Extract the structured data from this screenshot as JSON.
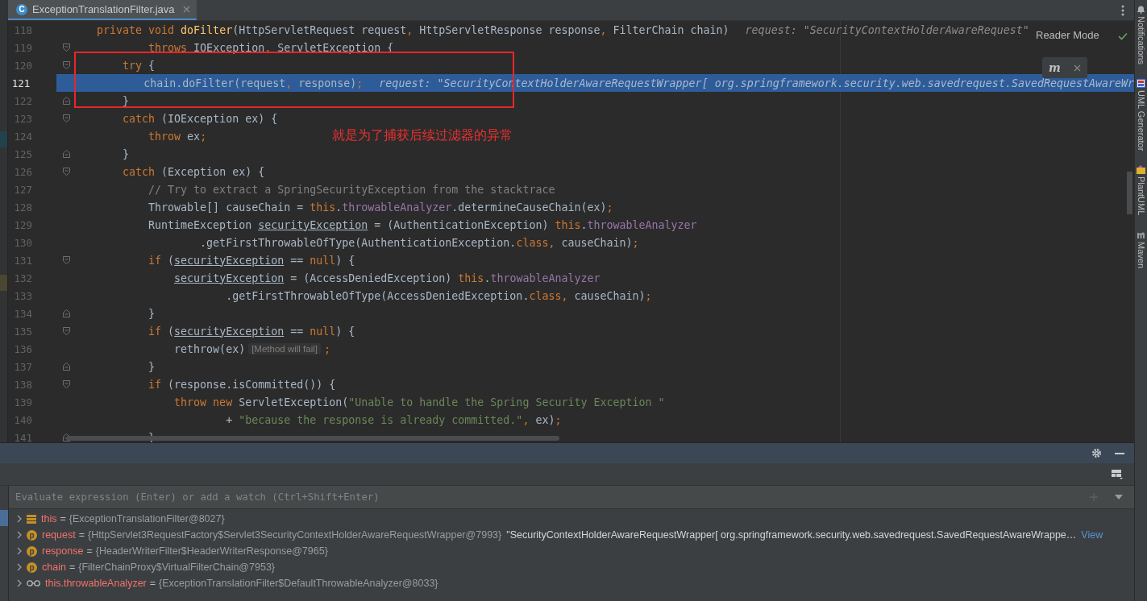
{
  "tab": {
    "icon_letter": "C",
    "label": "ExceptionTranslationFilter.java",
    "selected": true
  },
  "editor": {
    "reader_mode": "Reader Mode",
    "maven_widget": {
      "logo": "m"
    },
    "lines": [
      {
        "number": "118",
        "fold_start": false,
        "fold_end": false,
        "selected": false,
        "tokens": [
          {
            "kind": "kw",
            "t": "    private void "
          },
          {
            "kind": "fn",
            "t": "doFilter"
          },
          {
            "kind": "txt",
            "t": "(HttpServletRequest request"
          },
          {
            "kind": "kw",
            "t": ","
          },
          {
            "kind": "txt",
            "t": " HttpServletResponse response"
          },
          {
            "kind": "kw",
            "t": ","
          },
          {
            "kind": "txt",
            "t": " FilterChain chain)"
          },
          {
            "kind": "hint",
            "t": "request: \"SecurityContextHolderAwareRequest\""
          }
        ]
      },
      {
        "number": "119",
        "fold_start": true,
        "fold_end": false,
        "selected": false,
        "tokens": [
          {
            "kind": "kw",
            "t": "            throws "
          },
          {
            "kind": "txt",
            "t": "IOException"
          },
          {
            "kind": "kw",
            "t": ","
          },
          {
            "kind": "txt",
            "t": " ServletException {"
          }
        ]
      },
      {
        "number": "120",
        "fold_start": true,
        "fold_end": false,
        "selected": false,
        "tokens": [
          {
            "kind": "kw",
            "t": "        try"
          },
          {
            "kind": "txt",
            "t": " {"
          }
        ]
      },
      {
        "number": "121",
        "fold_start": false,
        "fold_end": false,
        "selected": true,
        "tokens": [
          {
            "kind": "txt",
            "t": "            chain.doFilter(request"
          },
          {
            "kind": "kw",
            "t": ","
          },
          {
            "kind": "txt",
            "t": " response)"
          },
          {
            "kind": "kw",
            "t": ";"
          },
          {
            "kind": "hint",
            "t": "request: \"SecurityContextHolderAwareRequestWrapper[ org.springframework.security.web.savedrequest.SavedRequestAwareWr"
          }
        ]
      },
      {
        "number": "122",
        "fold_start": false,
        "fold_end": true,
        "selected": false,
        "tokens": [
          {
            "kind": "txt",
            "t": "        }"
          }
        ]
      },
      {
        "number": "123",
        "fold_start": true,
        "fold_end": false,
        "selected": false,
        "tokens": [
          {
            "kind": "kw",
            "t": "        catch"
          },
          {
            "kind": "txt",
            "t": " (IOException ex) {"
          }
        ]
      },
      {
        "number": "124",
        "fold_start": false,
        "fold_end": false,
        "selected": false,
        "tokens": [
          {
            "kind": "kw",
            "t": "            throw"
          },
          {
            "kind": "txt",
            "t": " ex"
          },
          {
            "kind": "kw",
            "t": ";"
          }
        ]
      },
      {
        "number": "125",
        "fold_start": false,
        "fold_end": true,
        "selected": false,
        "tokens": [
          {
            "kind": "txt",
            "t": "        }"
          }
        ]
      },
      {
        "number": "126",
        "fold_start": true,
        "fold_end": false,
        "selected": false,
        "tokens": [
          {
            "kind": "kw",
            "t": "        catch"
          },
          {
            "kind": "txt",
            "t": " (Exception ex) {"
          }
        ]
      },
      {
        "number": "127",
        "fold_start": false,
        "fold_end": false,
        "selected": false,
        "tokens": [
          {
            "kind": "cmt",
            "t": "            // Try to extract a SpringSecurityException from the stacktrace"
          }
        ]
      },
      {
        "number": "128",
        "fold_start": false,
        "fold_end": false,
        "selected": false,
        "tokens": [
          {
            "kind": "txt",
            "t": "            Throwable[] causeChain = "
          },
          {
            "kind": "kw",
            "t": "this"
          },
          {
            "kind": "field",
            "t": ".throwableAnalyzer"
          },
          {
            "kind": "txt",
            "t": ".determineCauseChain(ex)"
          },
          {
            "kind": "kw",
            "t": ";"
          }
        ]
      },
      {
        "number": "129",
        "fold_start": false,
        "fold_end": false,
        "selected": false,
        "tokens": [
          {
            "kind": "txt",
            "t": "            RuntimeException "
          },
          {
            "kind": "ul",
            "t": "securityException"
          },
          {
            "kind": "txt",
            "t": " = (AuthenticationException) "
          },
          {
            "kind": "kw",
            "t": "this"
          },
          {
            "kind": "field",
            "t": ".throwableAnalyzer"
          }
        ]
      },
      {
        "number": "130",
        "fold_start": false,
        "fold_end": false,
        "selected": false,
        "tokens": [
          {
            "kind": "txt",
            "t": "                    .getFirstThrowableOfType(AuthenticationException."
          },
          {
            "kind": "kw",
            "t": "class"
          },
          {
            "kind": "kw",
            "t": ","
          },
          {
            "kind": "txt",
            "t": " causeChain)"
          },
          {
            "kind": "kw",
            "t": ";"
          }
        ]
      },
      {
        "number": "131",
        "fold_start": true,
        "fold_end": false,
        "selected": false,
        "tokens": [
          {
            "kind": "kw",
            "t": "            if"
          },
          {
            "kind": "txt",
            "t": " ("
          },
          {
            "kind": "ul",
            "t": "securityException"
          },
          {
            "kind": "txt",
            "t": " == "
          },
          {
            "kind": "kw",
            "t": "null"
          },
          {
            "kind": "txt",
            "t": ") {"
          }
        ]
      },
      {
        "number": "132",
        "fold_start": false,
        "fold_end": false,
        "selected": false,
        "tokens": [
          {
            "kind": "ul",
            "t": "                securityException"
          },
          {
            "kind": "txt",
            "t": " = (AccessDeniedException) "
          },
          {
            "kind": "kw",
            "t": "this"
          },
          {
            "kind": "field",
            "t": ".throwableAnalyzer"
          }
        ]
      },
      {
        "number": "133",
        "fold_start": false,
        "fold_end": false,
        "selected": false,
        "tokens": [
          {
            "kind": "txt",
            "t": "                        .getFirstThrowableOfType(AccessDeniedException."
          },
          {
            "kind": "kw",
            "t": "class"
          },
          {
            "kind": "kw",
            "t": ","
          },
          {
            "kind": "txt",
            "t": " causeChain)"
          },
          {
            "kind": "kw",
            "t": ";"
          }
        ]
      },
      {
        "number": "134",
        "fold_start": false,
        "fold_end": true,
        "selected": false,
        "tokens": [
          {
            "kind": "txt",
            "t": "            }"
          }
        ]
      },
      {
        "number": "135",
        "fold_start": true,
        "fold_end": false,
        "selected": false,
        "tokens": [
          {
            "kind": "kw",
            "t": "            if"
          },
          {
            "kind": "txt",
            "t": " ("
          },
          {
            "kind": "ul",
            "t": "securityException"
          },
          {
            "kind": "txt",
            "t": " == "
          },
          {
            "kind": "kw",
            "t": "null"
          },
          {
            "kind": "txt",
            "t": ") {"
          }
        ]
      },
      {
        "number": "136",
        "fold_start": false,
        "fold_end": false,
        "selected": false,
        "tokens": [
          {
            "kind": "txt",
            "t": "                rethrow(ex)"
          },
          {
            "kind": "chip",
            "t": "[Method will fail]"
          },
          {
            "kind": "kw",
            "t": ";"
          }
        ]
      },
      {
        "number": "137",
        "fold_start": false,
        "fold_end": true,
        "selected": false,
        "tokens": [
          {
            "kind": "txt",
            "t": "            }"
          }
        ]
      },
      {
        "number": "138",
        "fold_start": true,
        "fold_end": false,
        "selected": false,
        "tokens": [
          {
            "kind": "kw",
            "t": "            if"
          },
          {
            "kind": "txt",
            "t": " (response.isCommitted()) {"
          }
        ]
      },
      {
        "number": "139",
        "fold_start": false,
        "fold_end": false,
        "selected": false,
        "tokens": [
          {
            "kind": "kw",
            "t": "                throw new "
          },
          {
            "kind": "txt",
            "t": "ServletException("
          },
          {
            "kind": "str",
            "t": "\"Unable to handle the Spring Security Exception \""
          }
        ]
      },
      {
        "number": "140",
        "fold_start": false,
        "fold_end": false,
        "selected": false,
        "tokens": [
          {
            "kind": "txt",
            "t": "                        + "
          },
          {
            "kind": "str",
            "t": "\"because the response is already committed.\""
          },
          {
            "kind": "kw",
            "t": ","
          },
          {
            "kind": "txt",
            "t": " ex)"
          },
          {
            "kind": "kw",
            "t": ";"
          }
        ]
      },
      {
        "number": "141",
        "fold_start": false,
        "fold_end": true,
        "selected": false,
        "tokens": [
          {
            "kind": "txt",
            "t": "            }"
          }
        ]
      }
    ],
    "annotation": "就是为了捕获后续过滤器的异常"
  },
  "debug": {
    "evaluate": {
      "placeholder": "Evaluate expression (Enter) or add a watch (Ctrl+Shift+Enter)"
    },
    "variables": [
      {
        "kind": "fields",
        "name": "this",
        "sep": "=",
        "value": "{ExceptionTranslationFilter@8027}"
      },
      {
        "kind": "param",
        "badge": "p",
        "name": "request",
        "sep": "=",
        "value": "{HttpServlet3RequestFactory$Servlet3SecurityContextHolderAwareRequestWrapper@7993}",
        "text": "\"SecurityContextHolderAwareRequestWrapper[ org.springframework.security.web.savedrequest.SavedRequestAwareWrappe…",
        "link": "View"
      },
      {
        "kind": "param",
        "badge": "p",
        "name": "response",
        "sep": "=",
        "value": "{HeaderWriterFilter$HeaderWriterResponse@7965}"
      },
      {
        "kind": "param",
        "badge": "p",
        "name": "chain",
        "sep": "=",
        "value": "{FilterChainProxy$VirtualFilterChain@7953}"
      },
      {
        "kind": "watch",
        "name": "this.throwableAnalyzer",
        "sep": "=",
        "value": "{ExceptionTranslationFilter$DefaultThrowableAnalyzer@8033}"
      }
    ]
  },
  "tool_strip": [
    {
      "kind": "notifications",
      "label": "Notifications"
    },
    {
      "kind": "uml",
      "label": "UML Generator"
    },
    {
      "kind": "plantuml",
      "label": "PlantUML"
    },
    {
      "kind": "maven",
      "label": "Maven"
    }
  ]
}
